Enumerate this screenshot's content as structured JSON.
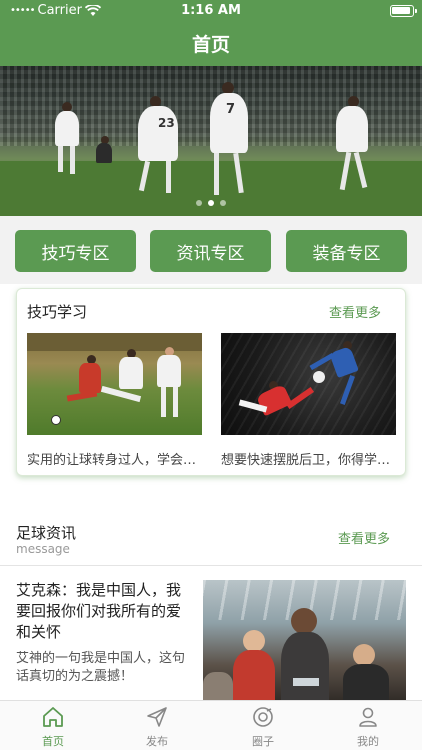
{
  "status_bar": {
    "carrier": "Carrier",
    "time": "1:16 AM"
  },
  "nav": {
    "title": "首页"
  },
  "banner": {
    "page_count": 3,
    "active_page": 1,
    "jersey_numbers": [
      "23",
      "7"
    ]
  },
  "zones": [
    {
      "label": "技巧专区"
    },
    {
      "label": "资讯专区"
    },
    {
      "label": "装备专区"
    }
  ],
  "skills": {
    "title": "技巧学习",
    "more": "查看更多",
    "items": [
      {
        "caption": "实用的让球转身过人，学会秒杀防守"
      },
      {
        "caption": "想要快速摆脱后卫，你得学会这招"
      }
    ]
  },
  "news": {
    "title": "足球资讯",
    "subtitle": "message",
    "more": "查看更多",
    "article": {
      "title": "艾克森：我是中国人，我要回报你们对我所有的爱和关怀",
      "desc": "艾神的一句我是中国人，这句话真切的为之震撼！"
    }
  },
  "tabbar": [
    {
      "label": "首页",
      "icon": "home-icon",
      "active": true
    },
    {
      "label": "发布",
      "icon": "send-icon",
      "active": false
    },
    {
      "label": "圈子",
      "icon": "circle-icon",
      "active": false
    },
    {
      "label": "我的",
      "icon": "person-icon",
      "active": false
    }
  ],
  "colors": {
    "primary": "#5b9a52",
    "inactive": "#888888"
  }
}
